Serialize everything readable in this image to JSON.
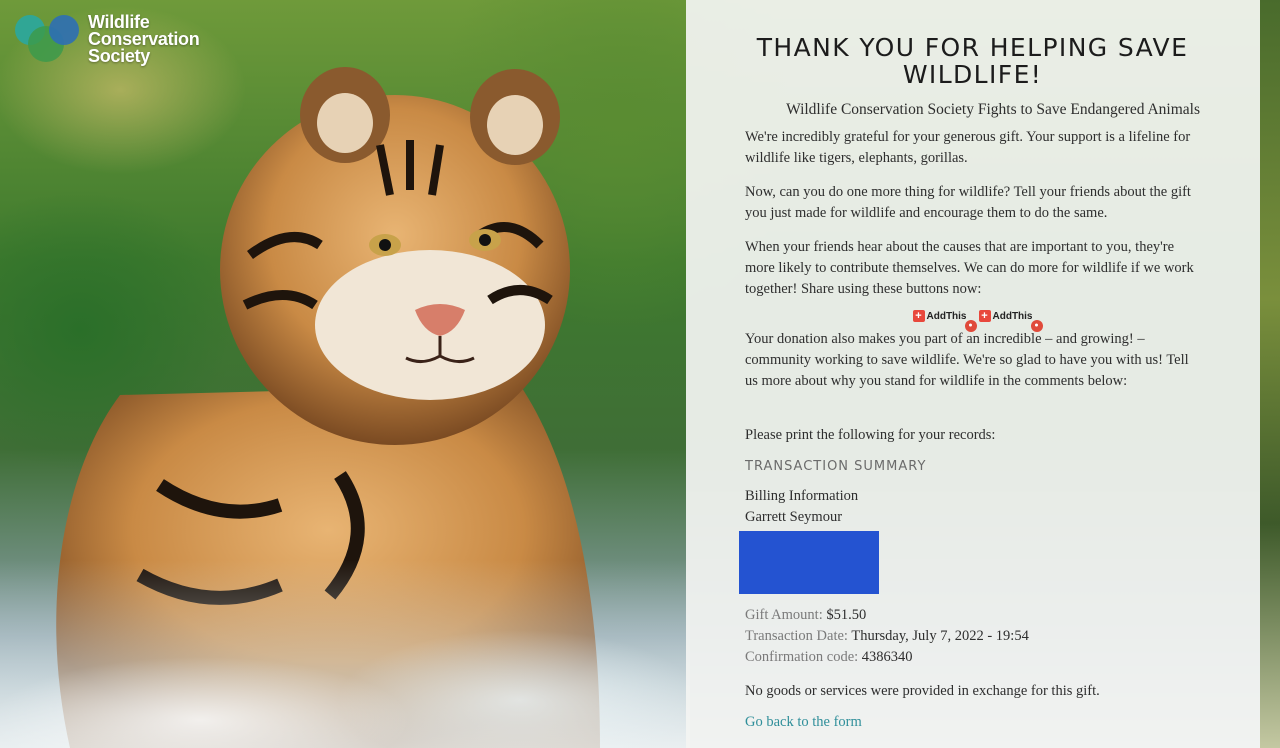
{
  "logo": {
    "line1": "Wildlife",
    "line2": "Conservation",
    "line3": "Society",
    "colors": {
      "teal": "#2aa7a0",
      "green": "#3c9a4b",
      "blue": "#2e6fb4"
    }
  },
  "panel": {
    "title": "THANK YOU FOR HELPING SAVE WILDLIFE!",
    "subtitle": "Wildlife Conservation Society Fights to Save Endangered Animals",
    "paragraphs": [
      "We're incredibly grateful for your generous gift. Your support is a lifeline for wildlife like tigers, elephants, gorillas.",
      "Now, can you do one more thing for wildlife? Tell your friends about the gift you just made for wildlife and encourage them to do the same.",
      "When your friends hear about the causes that are important to you, they're more likely to contribute themselves. We can do more for wildlife if we work together! Share using these buttons now:",
      "Your donation also makes you part of an incredible – and growing! – community working to save wildlife. We're so glad to have you with us! Tell us more about why you stand for wildlife in the comments below:"
    ],
    "share_buttons": [
      {
        "label": "AddThis",
        "icon": "plus-icon"
      },
      {
        "label": "AddThis",
        "icon": "plus-icon"
      }
    ],
    "print_note": "Please print the following for your records:",
    "summary_title": "TRANSACTION SUMMARY",
    "billing": {
      "label": "Billing Information",
      "name": "Garrett Seymour"
    },
    "gift_amount": {
      "label": "Gift Amount:",
      "value": "$51.50"
    },
    "transaction_date": {
      "label": "Transaction Date:",
      "value": "Thursday, July 7, 2022 - 19:54"
    },
    "confirmation": {
      "label": "Confirmation code:",
      "value": "4386340"
    },
    "no_goods": "No goods or services were provided in exchange for this gift.",
    "back_link": "Go back to the form"
  },
  "colors": {
    "panel_bg": "#f3f4f2",
    "link": "#2f8f9a",
    "redaction": "#2453d1",
    "addthis_red": "#e8483c"
  }
}
